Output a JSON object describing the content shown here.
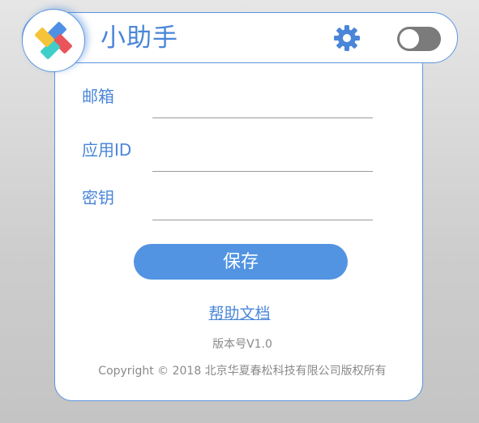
{
  "header": {
    "title": "小助手",
    "settings_icon": "gear-icon",
    "toggle_state": "off"
  },
  "form": {
    "email_label": "邮箱",
    "email_value": "",
    "appid_label": "应用ID",
    "appid_value": "",
    "secret_label": "密钥",
    "secret_value": ""
  },
  "actions": {
    "save_label": "保存",
    "help_label": "帮助文档"
  },
  "footer": {
    "version": "版本号V1.0",
    "copyright": "Copyright © 2018 北京华夏春松科技有限公司版权所有"
  },
  "colors": {
    "accent": "#5294e2",
    "text_blue": "#4a86d8",
    "logo_yellow": "#f5c43b",
    "logo_blue": "#4f8fe6",
    "logo_red": "#e9555a",
    "logo_teal": "#3fcfc9"
  }
}
